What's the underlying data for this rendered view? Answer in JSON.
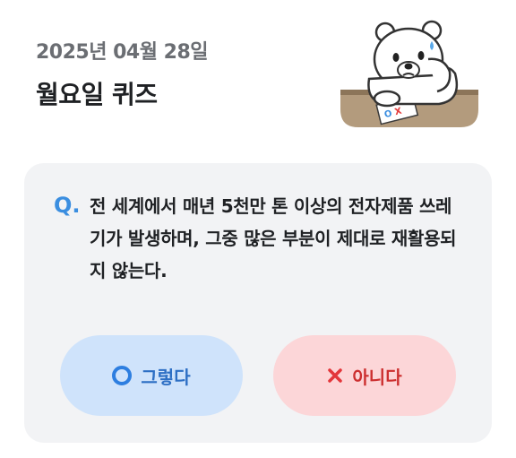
{
  "header": {
    "date": "2025년 04월 28일",
    "title": "월요일 퀴즈"
  },
  "quiz": {
    "q_mark": "Q.",
    "question": "전 세계에서 매년 5천만 톤 이상의 전자제품 쓰레기가 발생하며, 그중 많은 부분이 제대로 재활용되지 않는다.",
    "yes_label": "그렇다",
    "no_label": "아니다",
    "yes_icon": "circle-o-icon",
    "no_icon": "x-mark-icon"
  },
  "mascot": {
    "icon": "polar-bear-mascot",
    "paper_mark": "OX"
  },
  "colors": {
    "accent_blue": "#3b8ee0",
    "yes_bg": "#cfe3fb",
    "no_bg": "#fcd6d8",
    "no_text": "#cc2f2f",
    "card_bg": "#f2f3f5"
  }
}
